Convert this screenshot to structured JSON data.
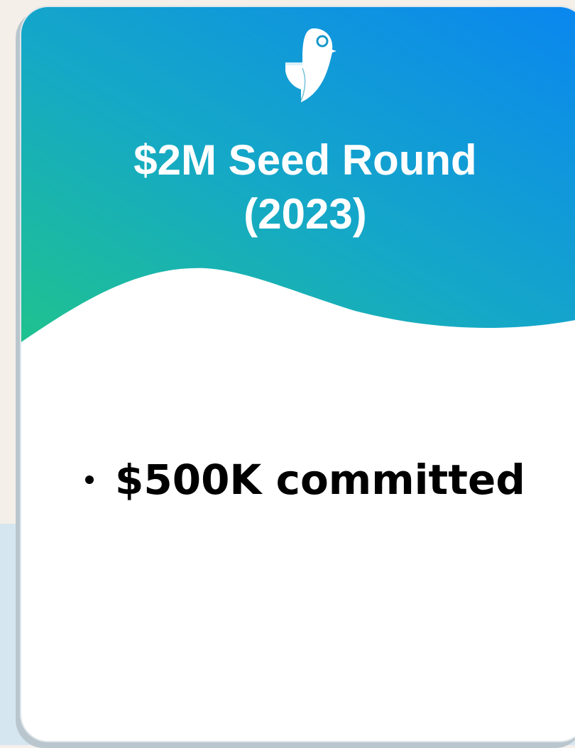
{
  "slide": {
    "title_line1": "$2M Seed Round",
    "title_line2": "(2023)",
    "bullets": [
      "$500K committed"
    ]
  },
  "colors": {
    "gradient_start": "#1fc28f",
    "gradient_mid": "#15a8c7",
    "gradient_end": "#0a86f0",
    "card_background": "#ffffff",
    "page_background": "#f4efe9",
    "page_background_lower": "#d6e6f0"
  },
  "icons": {
    "logo": "bird-logo-icon"
  }
}
